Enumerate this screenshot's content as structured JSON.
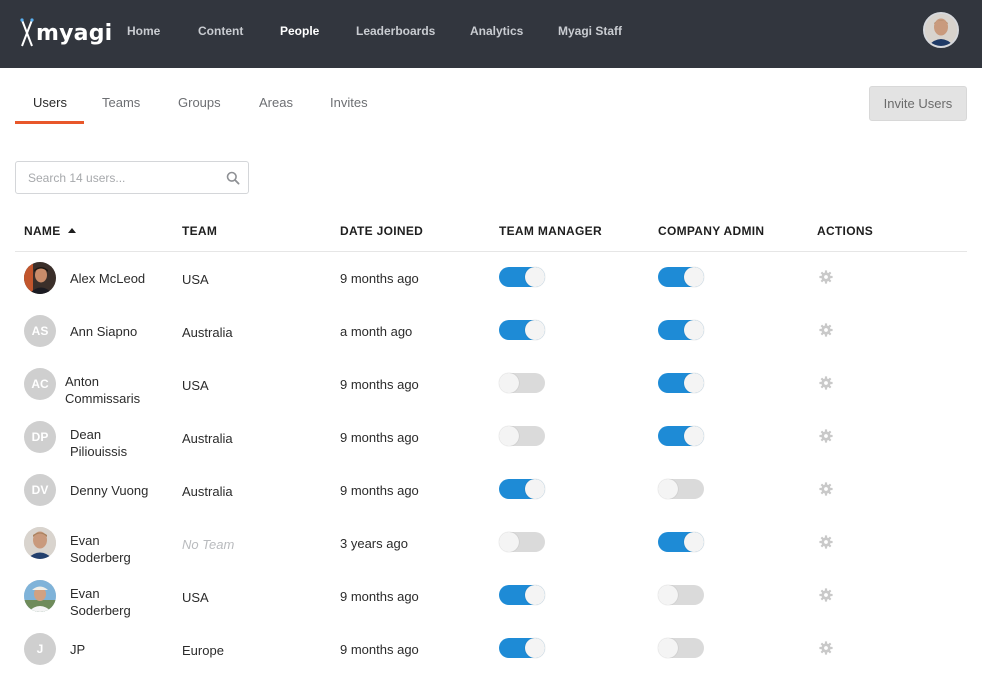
{
  "app": {
    "logo_text": "myagi",
    "nav": [
      {
        "label": "Home",
        "active": false
      },
      {
        "label": "Content",
        "active": false
      },
      {
        "label": "People",
        "active": true
      },
      {
        "label": "Leaderboards",
        "active": false
      },
      {
        "label": "Analytics",
        "active": false
      },
      {
        "label": "Myagi Staff",
        "active": false
      }
    ]
  },
  "tabs": [
    {
      "label": "Users",
      "active": true
    },
    {
      "label": "Teams",
      "active": false
    },
    {
      "label": "Groups",
      "active": false
    },
    {
      "label": "Areas",
      "active": false
    },
    {
      "label": "Invites",
      "active": false
    }
  ],
  "invite_button": "Invite Users",
  "search": {
    "placeholder": "Search 14 users...",
    "value": ""
  },
  "table": {
    "headers": {
      "name": "NAME",
      "team": "TEAM",
      "date_joined": "DATE JOINED",
      "team_manager": "TEAM MANAGER",
      "company_admin": "COMPANY ADMIN",
      "actions": "ACTIONS"
    },
    "sort": {
      "column": "name",
      "direction": "ascending"
    },
    "rows": [
      {
        "initials": "",
        "photo": "photo-dark",
        "name": "Alex McLeod",
        "team": "USA",
        "date_joined": "9 months ago",
        "team_manager": true,
        "company_admin": true
      },
      {
        "initials": "AS",
        "photo": "",
        "name": "Ann Siapno",
        "team": "Australia",
        "date_joined": "a month ago",
        "team_manager": true,
        "company_admin": true
      },
      {
        "initials": "AC",
        "photo": "",
        "name": "Anton Commissaris",
        "team": "USA",
        "date_joined": "9 months ago",
        "team_manager": false,
        "company_admin": true
      },
      {
        "initials": "DP",
        "photo": "",
        "name": "Dean Piliouissis",
        "team": "Australia",
        "date_joined": "9 months ago",
        "team_manager": false,
        "company_admin": true
      },
      {
        "initials": "DV",
        "photo": "",
        "name": "Denny Vuong",
        "team": "Australia",
        "date_joined": "9 months ago",
        "team_manager": true,
        "company_admin": false
      },
      {
        "initials": "",
        "photo": "photo-light",
        "name": "Evan Soderberg",
        "team": "No Team",
        "date_joined": "3 years ago",
        "team_manager": false,
        "company_admin": true
      },
      {
        "initials": "",
        "photo": "photo-outdoor",
        "name": "Evan Soderberg",
        "team": "USA",
        "date_joined": "9 months ago",
        "team_manager": true,
        "company_admin": false
      },
      {
        "initials": "J",
        "photo": "",
        "name": "JP",
        "team": "Europe",
        "date_joined": "9 months ago",
        "team_manager": true,
        "company_admin": false
      }
    ]
  },
  "colors": {
    "topbar": "#32363e",
    "accent_underline": "#e8572a",
    "toggle_on": "#1e8bd6",
    "toggle_off": "#dadada",
    "avatar_placeholder": "#cfcfcf"
  },
  "icons": {
    "search": "search-icon",
    "action": "gear-icon",
    "sort": "sort-ascending-icon"
  }
}
